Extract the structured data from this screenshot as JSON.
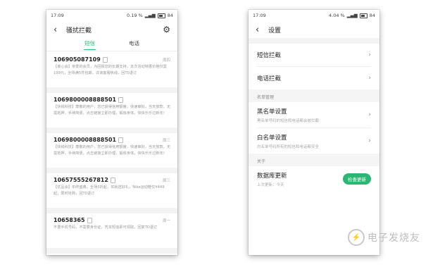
{
  "left": {
    "status": {
      "time": "17:09",
      "speed": "0.19 %",
      "battery": "84"
    },
    "title": "骚扰拦截",
    "tabs": [
      {
        "label": "短信"
      },
      {
        "label": "电话"
      }
    ],
    "messages": [
      {
        "number": "106905087109",
        "date": "周四",
        "body": "【孝心会】亲爱的会员，为回报您的长期支持，本次活动特惠价格仅需199元，全场满5件包邮，详询客服热线，回T0退订"
      },
      {
        "number": "1069800008888501",
        "date": "",
        "body": "【快钱科技】尊敬的用户，您已获得信用额度，快速审批，当天放款，无需抵押，手续简便，点击链接立即办理，锻炼身体，快快乐乐过新年！"
      },
      {
        "number": "1069800008888501",
        "date": "周三",
        "body": "【快钱科技】尊敬的用户，您已获得信用额度，快速审批，当天放款，无需抵押，手续简便，点击链接立即办理，锻炼身体，快快乐乐过新年！"
      },
      {
        "number": "10657555267812",
        "date": "周三",
        "body": "【优品会】年终盛典，全场5折起，买就送好礼，Nike运动鞋仅¥449起，限时抢购，回T0退订"
      },
      {
        "number": "10658365",
        "date": "周一",
        "body": "不要手机号码，不需要身份证，凭本短信即可领取，回复TD退订"
      }
    ]
  },
  "right": {
    "status": {
      "time": "17:09",
      "speed": "4.04 %",
      "battery": "84"
    },
    "title": "设置",
    "rows": {
      "sms_block": "短信拦截",
      "call_block": "电话拦截",
      "list_mgmt_header": "名单管理",
      "blacklist": {
        "title": "黑名单设置",
        "subtitle": "黑名单号码的短信和电话都会被拦截"
      },
      "whitelist": {
        "title": "白名单设置",
        "subtitle": "白名单号码所有的短信和电话都安全"
      },
      "about_header": "关于",
      "db_update": {
        "title": "数据库更新",
        "subtitle": "上次更新：今天",
        "button": "检查更新"
      }
    }
  },
  "watermark": {
    "text": "电子发烧友"
  },
  "colors": {
    "accent": "#2bb673",
    "divider": "#f3f3f3"
  },
  "icons": {
    "back": "back-arrow-icon",
    "settings": "gear-icon",
    "chevron": "chevron-right-icon"
  }
}
